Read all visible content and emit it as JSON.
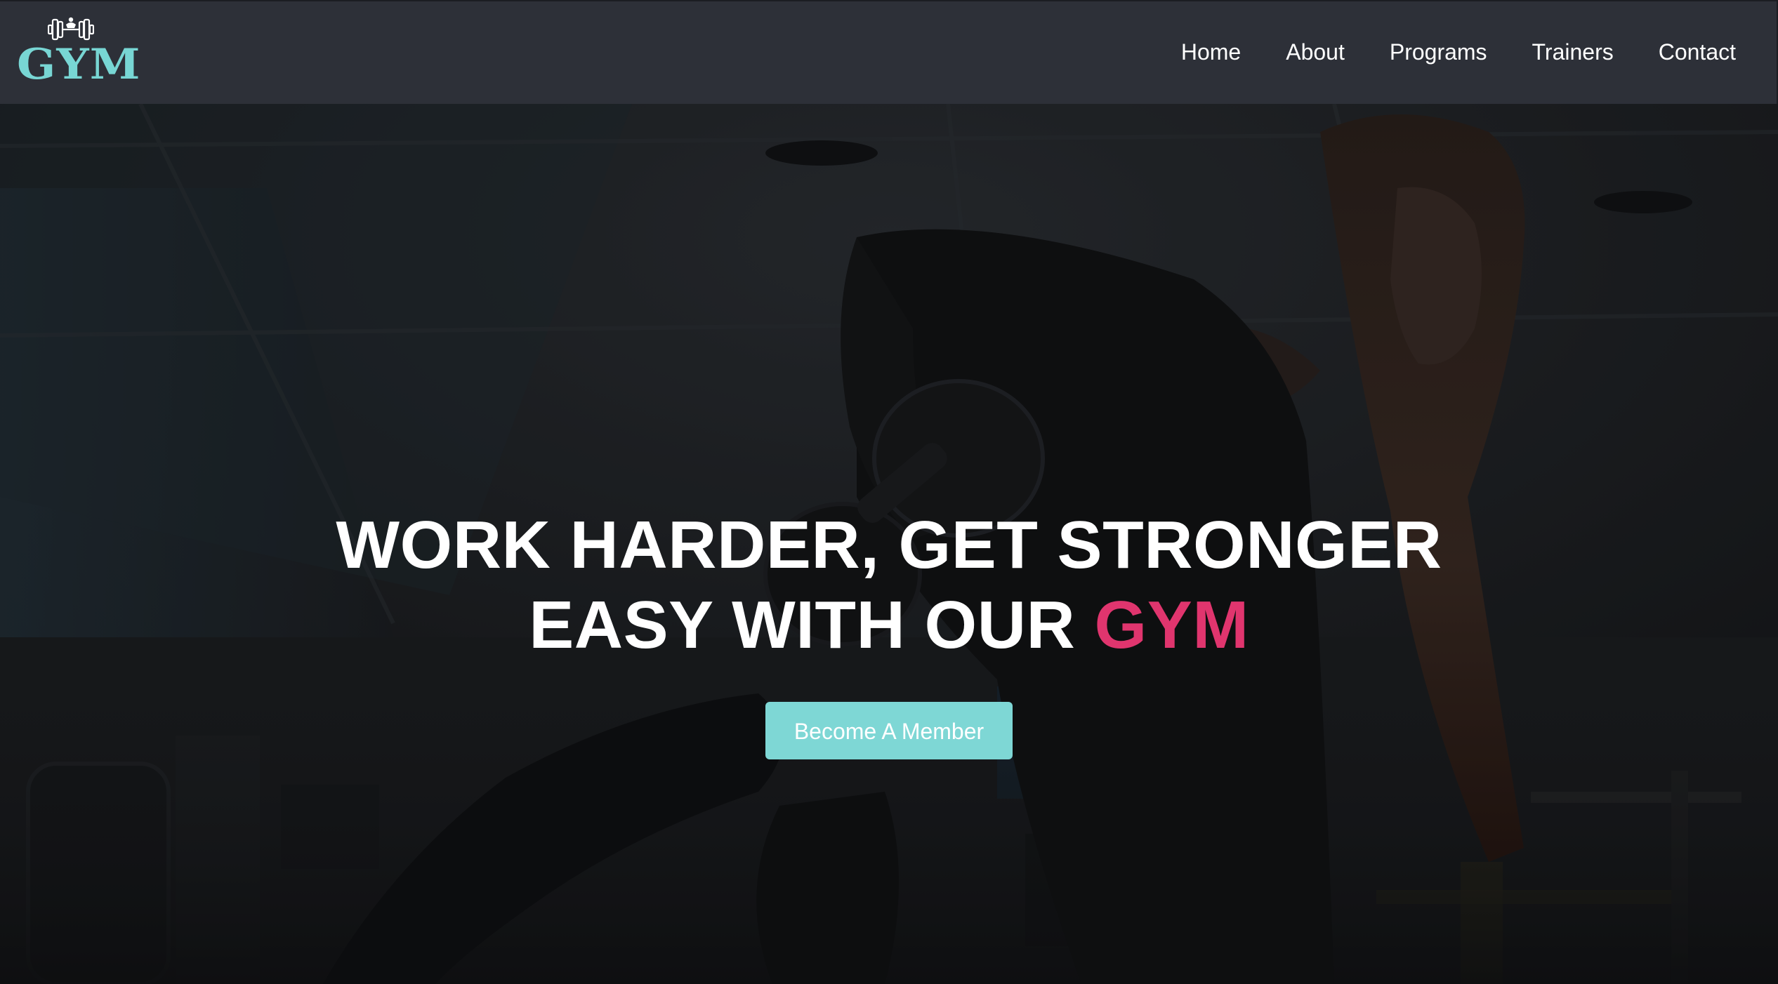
{
  "brand": {
    "name": "GYM",
    "icon": "dumbbell-icon",
    "color": "#78d6d4"
  },
  "nav": {
    "items": [
      {
        "label": "Home"
      },
      {
        "label": "About"
      },
      {
        "label": "Programs"
      },
      {
        "label": "Trainers"
      },
      {
        "label": "Contact"
      }
    ]
  },
  "hero": {
    "headline_line1": "WORK HARDER, GET STRONGER",
    "headline_line2_prefix": "EASY WITH OUR ",
    "headline_accent": "GYM",
    "accent_color": "#e0356e",
    "cta_label": "Become A Member",
    "cta_color": "#7ed7d5"
  },
  "colors": {
    "navbar_bg": "#2d3038",
    "hero_overlay": "#0a0b0d"
  }
}
